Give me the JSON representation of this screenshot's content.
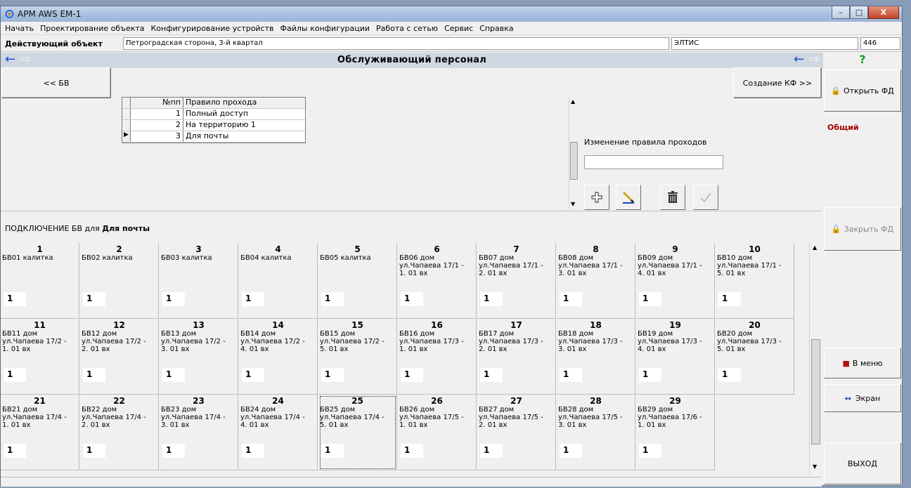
{
  "window": {
    "title": "АРМ AWS EM-1",
    "buttons": {
      "minimize": "–",
      "maximize": "□",
      "close": "X"
    }
  },
  "menu": [
    "Начать",
    "Проектирование объекта",
    "Конфигурирование устройств",
    "Файлы конфигурации",
    "Работа с сетью",
    "Сервис",
    "Справка"
  ],
  "object": {
    "label": "Действующий объект",
    "address": "Петроградская сторона, 3-й квартал",
    "vendor": "ЭЛТИС",
    "number": "446"
  },
  "section": {
    "title": "Обслуживающий персонал",
    "back_button": "<< БВ",
    "create_button": "Создание КФ >>"
  },
  "rules_table": {
    "headers": [
      "№пп",
      "Правило прохода"
    ],
    "rows": [
      {
        "num": "1",
        "rule": "Полный доступ"
      },
      {
        "num": "2",
        "rule": "На территорию 1"
      },
      {
        "num": "3",
        "rule": "Для почты"
      }
    ]
  },
  "edit": {
    "label": "Изменение правила проходов",
    "value": ""
  },
  "connection": {
    "label": "ПОДКЛЮЧЕНИЕ БВ для",
    "target": "Для почты"
  },
  "cells": [
    {
      "n": "1",
      "d": "БВ01 калитка",
      "v": "1"
    },
    {
      "n": "2",
      "d": "БВ02 калитка",
      "v": "1"
    },
    {
      "n": "3",
      "d": "БВ03 калитка",
      "v": "1"
    },
    {
      "n": "4",
      "d": "БВ04 калитка",
      "v": "1"
    },
    {
      "n": "5",
      "d": "БВ05 калитка",
      "v": "1"
    },
    {
      "n": "6",
      "d": "БВ06 дом\nул.Чапаева 17/1 -\n1. 01 вх",
      "v": "1"
    },
    {
      "n": "7",
      "d": "БВ07 дом\nул.Чапаева 17/1 -\n2. 01 вх",
      "v": "1"
    },
    {
      "n": "8",
      "d": "БВ08 дом\nул.Чапаева 17/1 -\n3. 01 вх",
      "v": "1"
    },
    {
      "n": "9",
      "d": "БВ09 дом\nул.Чапаева 17/1 -\n4. 01 вх",
      "v": "1"
    },
    {
      "n": "10",
      "d": "БВ10 дом\nул.Чапаева 17/1 -\n5. 01 вх",
      "v": "1"
    },
    {
      "n": "11",
      "d": "БВ11 дом\nул.Чапаева 17/2 -\n1. 01 вх",
      "v": "1"
    },
    {
      "n": "12",
      "d": "БВ12 дом\nул.Чапаева 17/2 -\n2. 01 вх",
      "v": "1"
    },
    {
      "n": "13",
      "d": "БВ13 дом\nул.Чапаева 17/2 -\n3. 01 вх",
      "v": "1"
    },
    {
      "n": "14",
      "d": "БВ14 дом\nул.Чапаева 17/2 -\n4. 01 вх",
      "v": "1"
    },
    {
      "n": "15",
      "d": "БВ15 дом\nул.Чапаева 17/2 -\n5. 01 вх",
      "v": "1"
    },
    {
      "n": "16",
      "d": "БВ16 дом\nул.Чапаева 17/3 -\n1. 01 вх",
      "v": "1"
    },
    {
      "n": "17",
      "d": "БВ17 дом\nул.Чапаева 17/3 -\n2. 01 вх",
      "v": "1"
    },
    {
      "n": "18",
      "d": "БВ18 дом\nул.Чапаева 17/3 -\n3. 01 вх",
      "v": "1"
    },
    {
      "n": "19",
      "d": "БВ19 дом\nул.Чапаева 17/3 -\n4. 01 вх",
      "v": "1"
    },
    {
      "n": "20",
      "d": "БВ20 дом\nул.Чапаева 17/3 -\n5. 01 вх",
      "v": "1"
    },
    {
      "n": "21",
      "d": "БВ21 дом\nул.Чапаева 17/4 -\n1. 01 вх",
      "v": "1"
    },
    {
      "n": "22",
      "d": "БВ22 дом\nул.Чапаева 17/4 -\n2. 01 вх",
      "v": "1"
    },
    {
      "n": "23",
      "d": "БВ23 дом\nул.Чапаева 17/4 -\n3. 01 вх",
      "v": "1"
    },
    {
      "n": "24",
      "d": "БВ24 дом\nул.Чапаева 17/4 -\n4. 01 вх",
      "v": "1"
    },
    {
      "n": "25",
      "d": "БВ25 дом\nул.Чапаева 17/4 -\n5. 01 вх",
      "v": "1"
    },
    {
      "n": "26",
      "d": "БВ26 дом\nул.Чапаева 17/5 -\n1. 01 вх",
      "v": "1"
    },
    {
      "n": "27",
      "d": "БВ27 дом\nул.Чапаева 17/5 -\n2. 01 вх",
      "v": "1"
    },
    {
      "n": "28",
      "d": "БВ28 дом\nул.Чапаева 17/5 -\n3. 01 вх",
      "v": "1"
    },
    {
      "n": "29",
      "d": "БВ29 дом\nул.Чапаева 17/6 -\n1. 01 вх",
      "v": "1"
    }
  ],
  "sidebar": {
    "help": "?",
    "open_fd": "Открыть ФД",
    "mode": "Общий",
    "close_fd": "Закрыть ФД",
    "to_menu": "В меню",
    "screen": "Экран",
    "exit": "ВЫХОД"
  },
  "colors": {
    "accent_blue": "#1f4fd6",
    "mode_red": "#a00000",
    "title_gradient": "#a9c1df"
  }
}
